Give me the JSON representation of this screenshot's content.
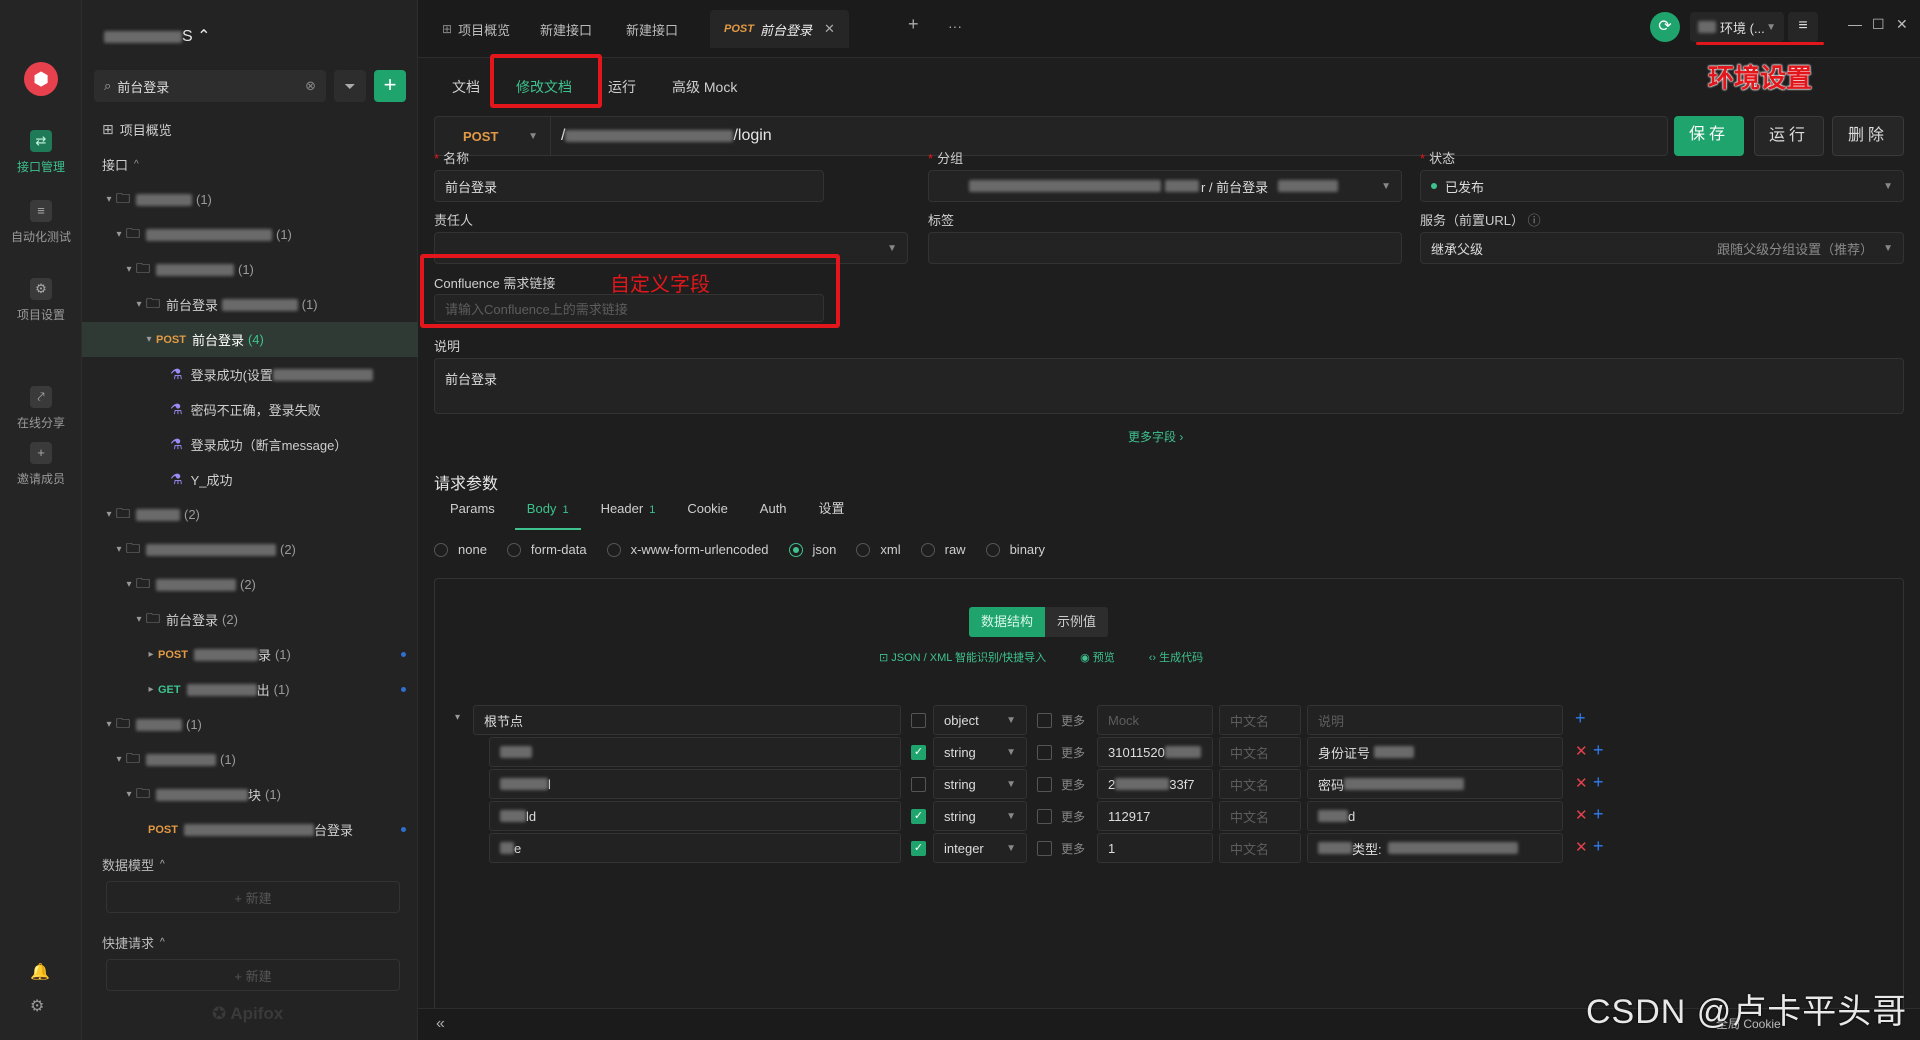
{
  "rail": {
    "items": [
      {
        "label": "接口管理",
        "icon": "api-icon"
      },
      {
        "label": "自动化测试",
        "icon": "automation-icon"
      },
      {
        "label": "项目设置",
        "icon": "settings-icon"
      },
      {
        "label": "在线分享",
        "icon": "share-icon"
      },
      {
        "label": "邀请成员",
        "icon": "invite-icon"
      }
    ]
  },
  "sidebar": {
    "project_suffix": "S",
    "search_value": "前台登录",
    "overview": "项目概览",
    "api_section": "接口",
    "tree": {
      "n1_cnt": "(1)",
      "n2_cnt": "(1)",
      "n3_cnt": "(1)",
      "n4_label": "前台登录",
      "n4_cnt": "(1)",
      "n5_method": "POST",
      "n5_label": "前台登录",
      "n5_cnt": "(4)",
      "cases": [
        "登录成功(设置",
        "密码不正确，登录失败",
        "登录成功（断言message）",
        "Y_成功"
      ],
      "m1_cnt": "(2)",
      "m2_cnt": "(2)",
      "m3_cnt": "(2)",
      "m4_label": "前台登录",
      "m4_cnt": "(2)",
      "m5_method": "POST",
      "m5_suffix": "录",
      "m5_cnt": "(1)",
      "m6_method": "GET",
      "m6_suffix": "出",
      "m6_cnt": "(1)",
      "k1_cnt": "(1)",
      "k2_cnt": "(1)",
      "k3_suffix": "块",
      "k3_cnt": "(1)",
      "k4_method": "POST",
      "k4_suffix": "台登录"
    },
    "data_model": "数据模型",
    "quick_request": "快捷请求",
    "new_label": "+ 新建",
    "brand": "Apifox"
  },
  "topbar": {
    "tabs": [
      {
        "label": "项目概览"
      },
      {
        "label": "新建接口"
      },
      {
        "label": "新建接口"
      },
      {
        "method": "POST",
        "label": "前台登录"
      }
    ],
    "env_label": "环境 (...",
    "env_callout": "环境设置"
  },
  "main": {
    "subtabs": [
      "文档",
      "修改文档",
      "运行",
      "高级 Mock"
    ],
    "method": "POST",
    "url_prefix": "/",
    "url_suffix": "/login",
    "save": "保存",
    "run": "运行",
    "delete": "删除",
    "fields": {
      "name_label": "名称",
      "name_value": "前台登录",
      "group_label": "分组",
      "group_value": "r / 前台登录",
      "status_label": "状态",
      "status_value": "已发布",
      "owner_label": "责任人",
      "tags_label": "标签",
      "service_label": "服务（前置URL）",
      "service_value": "继承父级",
      "service_hint": "跟随父级分组设置（推荐）",
      "confluence_label": "Confluence 需求链接",
      "confluence_placeholder": "请输入Confluence上的需求链接",
      "custom_callout": "自定义字段",
      "desc_label": "说明",
      "desc_value": "前台登录",
      "more_fields": "更多字段 ›"
    },
    "req_params": "请求参数",
    "ptabs": [
      {
        "label": "Params",
        "badge": ""
      },
      {
        "label": "Body",
        "badge": "1"
      },
      {
        "label": "Header",
        "badge": "1"
      },
      {
        "label": "Cookie",
        "badge": ""
      },
      {
        "label": "Auth",
        "badge": ""
      },
      {
        "label": "设置",
        "badge": ""
      }
    ],
    "body_types": [
      "none",
      "form-data",
      "x-www-form-urlencoded",
      "json",
      "xml",
      "raw",
      "binary"
    ],
    "body_selected": "json",
    "seg_on": "数据结构",
    "seg_off": "示例值",
    "tools": [
      "JSON / XML 智能识别/快捷导入",
      "预览",
      "生成代码"
    ],
    "schema": {
      "root_label": "根节点",
      "root_type": "object",
      "more": "更多",
      "mock_ph": "Mock",
      "cn_ph": "中文名",
      "desc_ph": "说明",
      "rows": [
        {
          "suffix": "",
          "type": "string",
          "mock": "31011520",
          "mock2": "",
          "desc": "身份证号",
          "required": true
        },
        {
          "suffix": "l",
          "type": "string",
          "mock": "2",
          "mock2": "33f7",
          "desc": "密码",
          "required": false
        },
        {
          "suffix": "ld",
          "type": "string",
          "mock": "112917",
          "mock2": "",
          "desc": "d",
          "required": true
        },
        {
          "suffix": "e",
          "type": "integer",
          "mock": "1",
          "mock2": "",
          "desc": "类型:",
          "required": true
        }
      ]
    }
  },
  "footer": {
    "watermark": "CSDN @卢卡平头哥",
    "cookie": "全局 Cookie"
  }
}
